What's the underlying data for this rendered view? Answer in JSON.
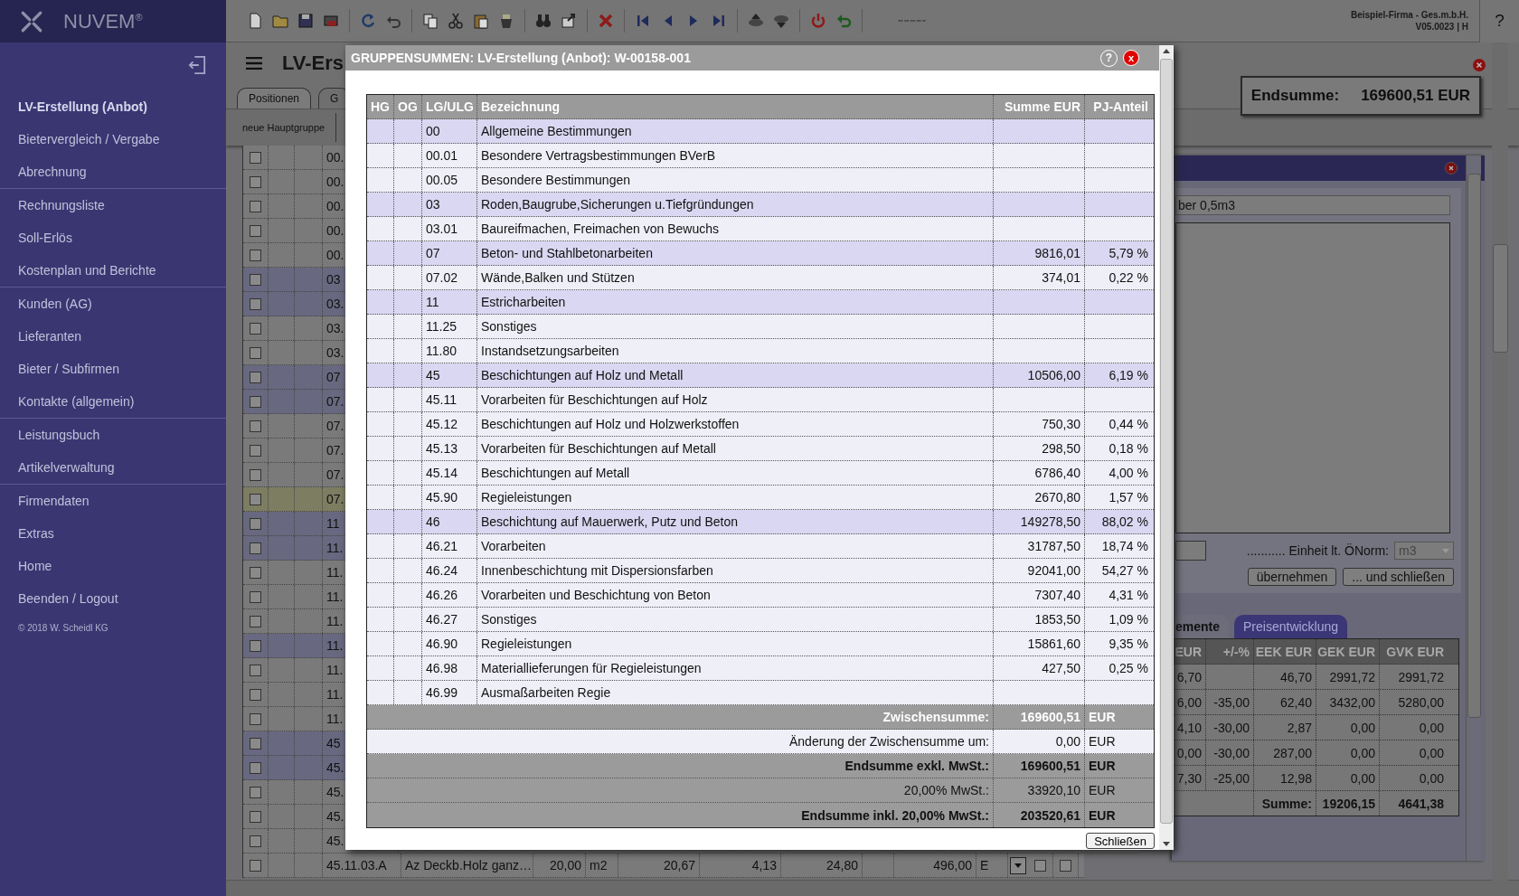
{
  "app": {
    "logo": "NUVEM$^{®}$",
    "company": "Beispiel-Firma - Ges.m.b.H.",
    "version": "V05.0023 | H",
    "help": "?"
  },
  "sidebar": {
    "groups": [
      {
        "items": [
          {
            "label": "LV-Erstellung (Anbot)",
            "selected": true
          },
          {
            "label": "Bietervergleich / Vergabe",
            "selected": false
          },
          {
            "label": "Abrechnung",
            "selected": false
          }
        ]
      },
      {
        "items": [
          {
            "label": "Rechnungsliste",
            "selected": false
          },
          {
            "label": "Soll-Erlös",
            "selected": false
          },
          {
            "label": "Kostenplan und Berichte",
            "selected": false
          }
        ]
      },
      {
        "items": [
          {
            "label": "Kunden (AG)",
            "selected": false
          },
          {
            "label": "Lieferanten",
            "selected": false
          },
          {
            "label": "Bieter / Subfirmen",
            "selected": false
          },
          {
            "label": "Kontakte (allgemein)",
            "selected": false
          }
        ]
      },
      {
        "items": [
          {
            "label": "Leistungsbuch",
            "selected": false
          },
          {
            "label": "Artikelverwaltung",
            "selected": false
          }
        ]
      },
      {
        "items": [
          {
            "label": "Firmendaten",
            "selected": false
          },
          {
            "label": "Extras",
            "selected": false
          },
          {
            "label": "Home",
            "selected": false
          },
          {
            "label": "Beenden / Logout",
            "selected": false
          }
        ]
      }
    ],
    "copyright": "© 2018 W. Scheidl KG"
  },
  "page": {
    "title": "LV-Ers",
    "tabs": [
      {
        "label": "Positionen",
        "selected": true
      },
      {
        "label": "G",
        "selected": false
      }
    ],
    "toolbar_button": "neue Hauptgruppe",
    "total": {
      "label": "Endsumme:",
      "value": "169600,51 EUR"
    },
    "rows": [
      {
        "code": "00.",
        "group": false,
        "selected": false,
        "checked": false
      },
      {
        "code": "00.",
        "group": false,
        "selected": false,
        "checked": false
      },
      {
        "code": "00.",
        "group": false,
        "selected": false,
        "checked": false
      },
      {
        "code": "00.",
        "group": false,
        "selected": false,
        "checked": false
      },
      {
        "code": "00.",
        "group": false,
        "selected": false,
        "checked": false
      },
      {
        "code": "03",
        "group": true,
        "selected": false,
        "checked": false
      },
      {
        "code": "03.",
        "group": true,
        "selected": false,
        "checked": false
      },
      {
        "code": "03.",
        "group": false,
        "selected": false,
        "checked": false
      },
      {
        "code": "03.",
        "group": false,
        "selected": false,
        "checked": false
      },
      {
        "code": "07",
        "group": true,
        "selected": false,
        "checked": false
      },
      {
        "code": "07.",
        "group": true,
        "selected": false,
        "checked": false
      },
      {
        "code": "07.",
        "group": false,
        "selected": false,
        "checked": false
      },
      {
        "code": "07.",
        "group": false,
        "selected": false,
        "checked": false
      },
      {
        "code": "07.",
        "group": false,
        "selected": false,
        "checked": false
      },
      {
        "code": "07.",
        "group": false,
        "selected": true,
        "checked": false
      },
      {
        "code": "11",
        "group": true,
        "selected": false,
        "checked": false
      },
      {
        "code": "11.",
        "group": true,
        "selected": false,
        "checked": false
      },
      {
        "code": "11.",
        "group": false,
        "selected": false,
        "checked": false
      },
      {
        "code": "11.",
        "group": false,
        "selected": false,
        "checked": false
      },
      {
        "code": "11.",
        "group": false,
        "selected": false,
        "checked": false
      },
      {
        "code": "11.",
        "group": true,
        "selected": false,
        "checked": false
      },
      {
        "code": "11.",
        "group": false,
        "selected": false,
        "checked": false
      },
      {
        "code": "11.",
        "group": false,
        "selected": false,
        "checked": false
      },
      {
        "code": "11.",
        "group": false,
        "selected": false,
        "checked": false
      },
      {
        "code": "45",
        "group": true,
        "selected": false,
        "checked": false
      },
      {
        "code": "45.",
        "group": true,
        "selected": false,
        "checked": false
      },
      {
        "code": "45.",
        "group": false,
        "selected": false,
        "checked": false
      },
      {
        "code": "45.",
        "group": false,
        "selected": false,
        "checked": false
      },
      {
        "code": "45.",
        "group": false,
        "selected": false,
        "checked": false
      }
    ],
    "last_row": {
      "checked": [
        false,
        false,
        false
      ],
      "cells": [
        "45.11.03.A",
        "Az Deckb.Holz ganz…",
        "20,00",
        "m2",
        "20,67",
        "4,13",
        "24,80",
        "496,00",
        "E"
      ]
    }
  },
  "detail_panel": {
    "field_value": "ber 0,5m3",
    "unit_label": "........... Einheit lt. ÖNorm:",
    "unit_value": "m3",
    "buttons": [
      "übernehmen",
      "... und schließen"
    ],
    "tabs": [
      {
        "label": "emente",
        "selected": true
      },
      {
        "label": "Preisentwicklung",
        "selected": false
      }
    ],
    "columns": [
      "EUR",
      "+/-%",
      "EEK EUR",
      "GEK EUR",
      "GVK EUR"
    ],
    "rows": [
      [
        "6,70",
        null,
        "46,70",
        "2991,72",
        "2991,72"
      ],
      [
        "6,00",
        "-35,00",
        "62,40",
        "3432,00",
        "5280,00"
      ],
      [
        "4,10",
        "-30,00",
        "2,87",
        "0,00",
        "0,00"
      ],
      [
        "0,00",
        "-30,00",
        "287,00",
        "0,00",
        "0,00"
      ],
      [
        "7,30",
        "-25,00",
        "12,98",
        "0,00",
        "0,00"
      ]
    ],
    "sum": {
      "label": "Summe:",
      "values": [
        "19206,15",
        "4641,38"
      ]
    }
  },
  "dialog": {
    "title": "GRUPPENSUMMEN: LV-Erstellung (Anbot): W-00158-001",
    "help": "?",
    "close": "x",
    "columns": [
      "HG",
      "OG",
      "LG/ULG",
      "Bezeichnung",
      "Summe EUR",
      "PJ-Anteil"
    ],
    "rows": [
      {
        "code": "00",
        "name": "Allgemeine Bestimmungen",
        "group": true
      },
      {
        "code": "00.01",
        "name": "Besondere Vertragsbestimmungen BVerB",
        "group": false
      },
      {
        "code": "00.05",
        "name": "Besondere Bestimmungen",
        "group": false
      },
      {
        "code": "03",
        "name": "Roden,Baugrube,Sicherungen u.Tiefgründungen",
        "group": true
      },
      {
        "code": "03.01",
        "name": "Baureifmachen, Freimachen von Bewuchs",
        "group": false
      },
      {
        "code": "07",
        "name": "Beton- und Stahlbetonarbeiten",
        "sum": "9816,01",
        "share": "5,79 %",
        "group": true
      },
      {
        "code": "07.02",
        "name": "Wände,Balken und Stützen",
        "sum": "374,01",
        "share": "0,22 %",
        "group": false
      },
      {
        "code": "11",
        "name": "Estricharbeiten",
        "group": true
      },
      {
        "code": "11.25",
        "name": "Sonstiges",
        "group": false
      },
      {
        "code": "11.80",
        "name": "Instandsetzungsarbeiten",
        "group": false
      },
      {
        "code": "45",
        "name": "Beschichtungen auf Holz und Metall",
        "sum": "10506,00",
        "share": "6,19 %",
        "group": true
      },
      {
        "code": "45.11",
        "name": "Vorarbeiten für Beschichtungen auf Holz",
        "group": false
      },
      {
        "code": "45.12",
        "name": "Beschichtungen auf Holz und Holzwerkstoffen",
        "sum": "750,30",
        "share": "0,44 %",
        "group": false
      },
      {
        "code": "45.13",
        "name": "Vorarbeiten für Beschichtungen auf Metall",
        "sum": "298,50",
        "share": "0,18 %",
        "group": false
      },
      {
        "code": "45.14",
        "name": "Beschichtungen auf Metall",
        "sum": "6786,40",
        "share": "4,00 %",
        "group": false
      },
      {
        "code": "45.90",
        "name": "Regieleistungen",
        "sum": "2670,80",
        "share": "1,57 %",
        "group": false
      },
      {
        "code": "46",
        "name": "Beschichtung auf Mauerwerk, Putz und Beton",
        "sum": "149278,50",
        "share": "88,02 %",
        "group": true
      },
      {
        "code": "46.21",
        "name": "Vorarbeiten",
        "sum": "31787,50",
        "share": "18,74 %",
        "group": false
      },
      {
        "code": "46.24",
        "name": "Innenbeschichtung mit Dispersionsfarben",
        "sum": "92041,00",
        "share": "54,27 %",
        "group": false
      },
      {
        "code": "46.26",
        "name": "Vorarbeiten und Beschichtung von Beton",
        "sum": "7307,40",
        "share": "4,31 %",
        "group": false
      },
      {
        "code": "46.27",
        "name": "Sonstiges",
        "sum": "1853,50",
        "share": "1,09 %",
        "group": false
      },
      {
        "code": "46.90",
        "name": "Regieleistungen",
        "sum": "15861,60",
        "share": "9,35 %",
        "group": false
      },
      {
        "code": "46.98",
        "name": "Materiallieferungen für Regieleistungen",
        "sum": "427,50",
        "share": "0,25 %",
        "group": false
      },
      {
        "code": "46.99",
        "name": "Ausmaßarbeiten Regie",
        "group": false
      }
    ],
    "summary": [
      {
        "kind": "subtotal",
        "label": "Zwischensumme:",
        "value": "169600,51",
        "unit": "EUR"
      },
      {
        "kind": "change",
        "label": "Änderung der Zwischensumme um:",
        "value": "0,00",
        "unit": "EUR"
      },
      {
        "kind": "total",
        "label": "Endsumme exkl. MwSt.:",
        "value": "169600,51",
        "unit": "EUR"
      },
      {
        "kind": "tax",
        "label": "20,00% MwSt.:",
        "value": "33920,10",
        "unit": "EUR"
      },
      {
        "kind": "total",
        "label": "Endsumme inkl. 20,00% MwSt.:",
        "value": "203520,61",
        "unit": "EUR"
      }
    ],
    "button": "Schließen"
  }
}
